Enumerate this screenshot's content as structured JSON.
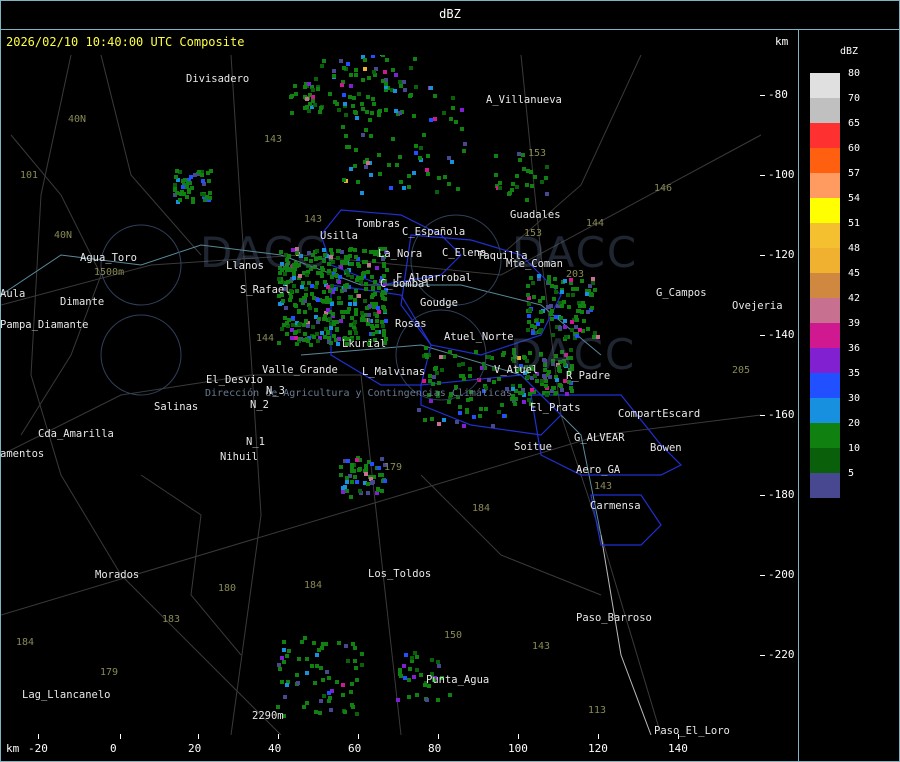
{
  "header": {
    "title": "dBZ",
    "timestamp": "2026/02/10 10:40:00 UTC Composite",
    "units_top": "km",
    "units_bottom": "km"
  },
  "x_axis": {
    "ticks": [
      "-20",
      "0",
      "20",
      "40",
      "60",
      "80",
      "100",
      "120",
      "140"
    ]
  },
  "y_axis": {
    "ticks": [
      "-80",
      "-100",
      "-120",
      "-140",
      "-160",
      "-180",
      "-200",
      "-220"
    ]
  },
  "legend": {
    "title": "dBZ",
    "items": [
      {
        "label": "80",
        "color": "#e0e0e0"
      },
      {
        "label": "70",
        "color": "#c0c0c0"
      },
      {
        "label": "65",
        "color": "#ff3030"
      },
      {
        "label": "60",
        "color": "#ff6010"
      },
      {
        "label": "57",
        "color": "#ff9a60"
      },
      {
        "label": "54",
        "color": "#ffff00"
      },
      {
        "label": "51",
        "color": "#f5c030"
      },
      {
        "label": "48",
        "color": "#f0b030"
      },
      {
        "label": "45",
        "color": "#d08840"
      },
      {
        "label": "42",
        "color": "#c87090"
      },
      {
        "label": "39",
        "color": "#d01890"
      },
      {
        "label": "36",
        "color": "#8020d0"
      },
      {
        "label": "35",
        "color": "#2050ff"
      },
      {
        "label": "30",
        "color": "#1890e0"
      },
      {
        "label": "20",
        "color": "#108010"
      },
      {
        "label": "10",
        "color": "#0a600a"
      },
      {
        "label": "5",
        "color": "#484890"
      }
    ]
  },
  "watermark": {
    "text": "DACC",
    "subtitle": "Dirección de Agricultura y Contingencias Climáticas"
  },
  "places": [
    {
      "name": "Divisadero",
      "id": "divisadero"
    },
    {
      "name": "A_Villanueva",
      "id": "a-villanueva"
    },
    {
      "name": "Guadales",
      "id": "guadales"
    },
    {
      "name": "Tombras",
      "id": "tombras"
    },
    {
      "name": "Usilla",
      "id": "usilla"
    },
    {
      "name": "C_Española",
      "id": "c-espanola"
    },
    {
      "name": "C_Elena",
      "id": "c-elena"
    },
    {
      "name": "Taquilla",
      "id": "taquilla"
    },
    {
      "name": "Mte_Coman",
      "id": "mte-coman"
    },
    {
      "name": "Agua_Toro",
      "id": "agua-toro"
    },
    {
      "name": "Llanos",
      "id": "llanos"
    },
    {
      "name": "La_Nora",
      "id": "la-nora"
    },
    {
      "name": "F_Algarrobal",
      "id": "f-algarrobal"
    },
    {
      "name": "C_bombal",
      "id": "c-bombal"
    },
    {
      "name": "S_Rafael",
      "id": "s-rafael"
    },
    {
      "name": "Goudge",
      "id": "goudge"
    },
    {
      "name": "G_Campos",
      "id": "g-campos"
    },
    {
      "name": "Ovejeria",
      "id": "ovejeria"
    },
    {
      "name": "Pampa_Diamante",
      "id": "pampa-diamante"
    },
    {
      "name": "Rosas",
      "id": "rosas"
    },
    {
      "name": "Atuel_Norte",
      "id": "atuel-norte"
    },
    {
      "name": "Aula",
      "id": "aula"
    },
    {
      "name": "Dimante",
      "id": "dimante"
    },
    {
      "name": "Lkurial",
      "id": "lkurial"
    },
    {
      "name": "Valle_Grande",
      "id": "valle-grande"
    },
    {
      "name": "El_Desvio",
      "id": "el-desvio"
    },
    {
      "name": "L_Malvinas",
      "id": "l-malvinas"
    },
    {
      "name": "V_Atuel",
      "id": "v-atuel"
    },
    {
      "name": "R_Padre",
      "id": "r-padre"
    },
    {
      "name": "Salinas",
      "id": "salinas"
    },
    {
      "name": "N_2",
      "id": "n-2"
    },
    {
      "name": "N_3",
      "id": "n-3"
    },
    {
      "name": "N_1",
      "id": "n-1"
    },
    {
      "name": "Nihuil",
      "id": "nihuil"
    },
    {
      "name": "El_Prats",
      "id": "el-prats"
    },
    {
      "name": "CompartEscard",
      "id": "compart-escard"
    },
    {
      "name": "Cda_Amarilla",
      "id": "cda-amarilla"
    },
    {
      "name": "amentos",
      "id": "amentos"
    },
    {
      "name": "G_ALVEAR",
      "id": "g-alvear"
    },
    {
      "name": "Soitue",
      "id": "soitue"
    },
    {
      "name": "Bowen",
      "id": "bowen"
    },
    {
      "name": "Aero_GA",
      "id": "aero-ga"
    },
    {
      "name": "Carmensa",
      "id": "carmensa"
    },
    {
      "name": "Morados",
      "id": "morados"
    },
    {
      "name": "Los_Toldos",
      "id": "los-toldos"
    },
    {
      "name": "Paso_Barroso",
      "id": "paso-barroso"
    },
    {
      "name": "Punta_Agua",
      "id": "punta-agua"
    },
    {
      "name": "Lag_Llancanelo",
      "id": "lag-llancanelo"
    },
    {
      "name": "Paso_El_Loro",
      "id": "paso-el-loro"
    },
    {
      "name": "2290m",
      "id": "elev-2290"
    }
  ],
  "roads": [
    "40N",
    "101",
    "40N",
    "143",
    "143",
    "153",
    "146",
    "153",
    "144",
    "203",
    "144",
    "205",
    "179",
    "184",
    "180",
    "184",
    "183",
    "179",
    "150",
    "143",
    "143",
    "184",
    "113",
    "1500m"
  ]
}
